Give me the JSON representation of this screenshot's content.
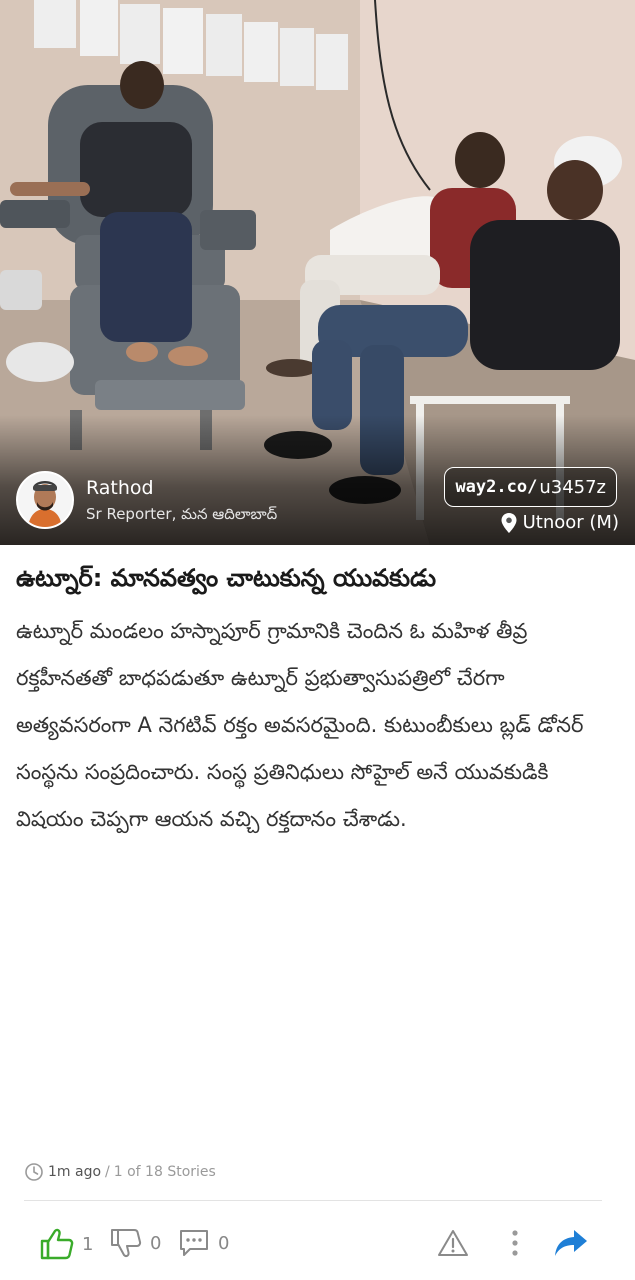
{
  "colors": {
    "accent": "#1f7fd6",
    "like_green": "#3aab2a",
    "text_dark": "#1a1a1a",
    "text_body": "#333333",
    "muted": "#9a9a9a"
  },
  "hero": {
    "reporter": {
      "name": "Rathod",
      "role": "Sr Reporter, మన ఆదిలాబాద్",
      "avatar_icon": "reporter-avatar"
    },
    "short_link": {
      "brand": "way2.co/",
      "code": "u3457z"
    },
    "location": {
      "icon": "location-pin-icon",
      "text": "Utnoor (M)"
    }
  },
  "article": {
    "headline": "ఉట్నూర్: మానవత్వం చాటుకున్న యువకుడు",
    "body": "ఉట్నూర్ మండలం హస్నాపూర్ గ్రామానికి చెందిన ఓ మహిళ తీవ్ర రక్తహీనతతో బాధపడుతూ ఉట్నూర్ ప్రభుత్వాసుపత్రిలో చేరగా అత్యవసరంగా A నెగటివ్ రక్తం అవసరమైంది. కుటుంబీకులు బ్లడ్ డోనర్ సంస్థను సంప్రదించారు. సంస్థ ప్రతినిధులు సోహైల్ అనే యువకుడికి విషయం చెప్పగా ఆయన వచ్చి రక్తదానం చేశాడు."
  },
  "meta": {
    "time": "1m ago",
    "separator": "/",
    "position": "1 of 18 Stories"
  },
  "actions": {
    "likes": "1",
    "dislikes": "0",
    "comments": "0",
    "icons": [
      "thumbs-up-icon",
      "thumbs-down-icon",
      "comment-icon",
      "report-warning-icon",
      "more-vertical-icon",
      "share-arrow-icon"
    ]
  }
}
